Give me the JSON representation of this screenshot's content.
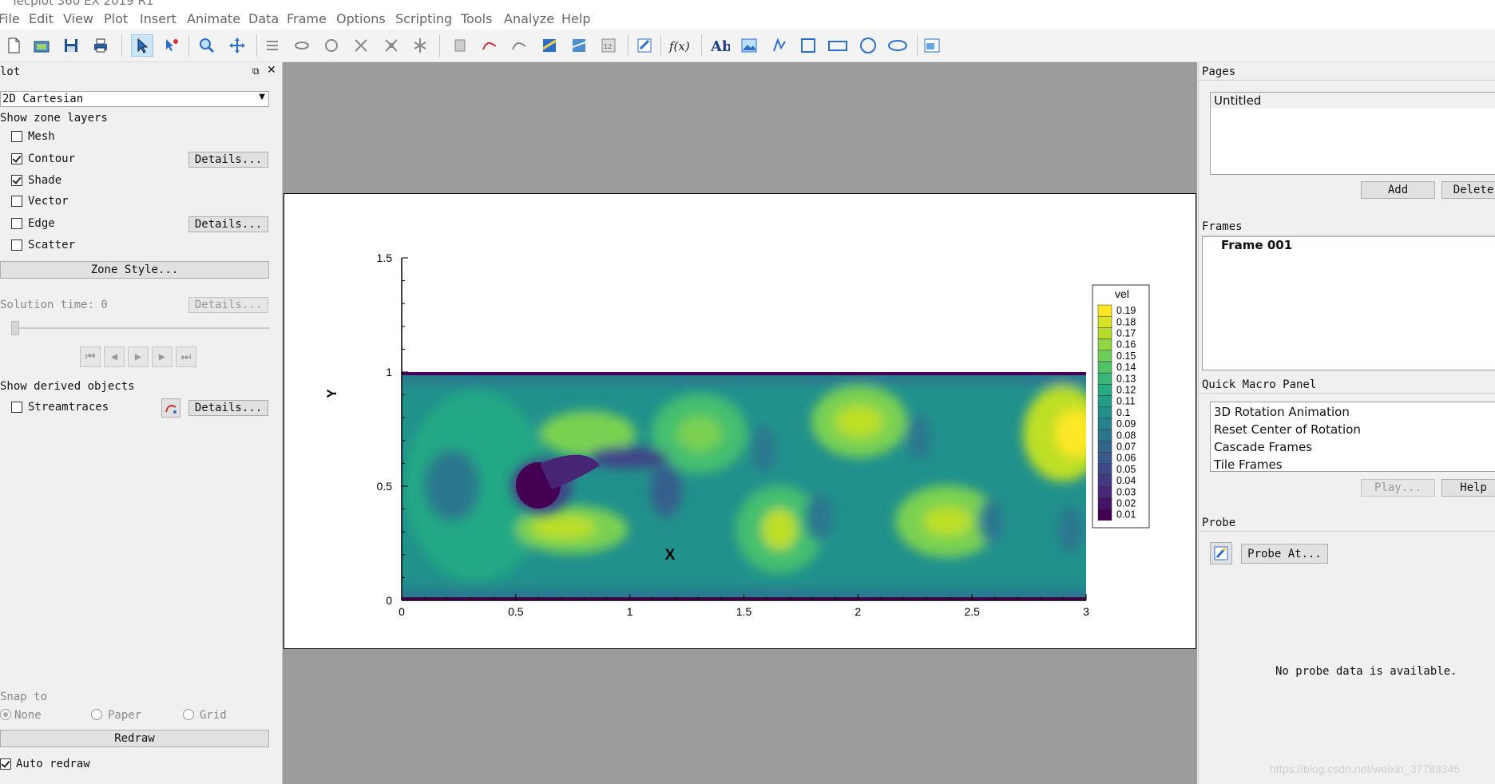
{
  "window": {
    "title": "Tecplot 360 EX 2019 R1"
  },
  "menu": [
    "File",
    "Edit",
    "View",
    "Plot",
    "Insert",
    "Animate",
    "Data",
    "Frame",
    "Options",
    "Scripting",
    "Tools",
    "Analyze",
    "Help"
  ],
  "left_panel": {
    "title": "lot",
    "plot_type": "2D Cartesian",
    "show_zone_layers": "Show zone layers",
    "layers": [
      {
        "label": "Mesh",
        "checked": false
      },
      {
        "label": "Contour",
        "checked": true,
        "details": "Details..."
      },
      {
        "label": "Shade",
        "checked": true
      },
      {
        "label": "Vector",
        "checked": false
      },
      {
        "label": "Edge",
        "checked": false,
        "details": "Details..."
      },
      {
        "label": "Scatter",
        "checked": false
      }
    ],
    "zone_style": "Zone Style...",
    "solution_time": "Solution time: 0",
    "solution_details": "Details...",
    "show_derived": "Show derived objects",
    "streamtraces": {
      "label": "Streamtraces",
      "checked": false,
      "details": "Details..."
    },
    "snap_to": "Snap to",
    "snap_options": [
      {
        "label": "None",
        "selected": true
      },
      {
        "label": "Paper",
        "selected": false
      },
      {
        "label": "Grid",
        "selected": false
      }
    ],
    "redraw": "Redraw",
    "auto_redraw": {
      "label": "Auto redraw",
      "checked": true
    }
  },
  "right_panel": {
    "pages_header": "Pages",
    "pages": [
      "Untitled"
    ],
    "add_button": "Add",
    "delete_button": "Delete",
    "frames_header": "Frames",
    "frames": [
      "Frame 001"
    ],
    "macro_header": "Quick Macro Panel",
    "macros": [
      "3D Rotation Animation",
      "Reset Center of Rotation",
      "Cascade Frames",
      "Tile Frames"
    ],
    "play_button": "Play...",
    "help_button": "Help",
    "probe_header": "Probe",
    "probe_button": "Probe At...",
    "probe_message": "No probe data is available."
  },
  "colors": {
    "accent": "#cce4f7",
    "workspace": "#9b9b9b"
  },
  "watermark": "https://blog.csdn.net/weixin_37783345",
  "chart_data": {
    "type": "heatmap",
    "xlabel": "X",
    "ylabel": "Y",
    "xlim": [
      0,
      3
    ],
    "ylim": [
      0,
      1.5
    ],
    "x_ticks": [
      "0",
      "0.5",
      "1",
      "1.5",
      "2",
      "2.5",
      "3"
    ],
    "y_ticks": [
      "0",
      "0.5",
      "1",
      "1.5"
    ],
    "domain": {
      "x": [
        0,
        3
      ],
      "y": [
        0,
        1
      ]
    },
    "legend": {
      "title": "vel",
      "placement": "right",
      "levels": [
        "0.19",
        "0.18",
        "0.17",
        "0.16",
        "0.15",
        "0.14",
        "0.13",
        "0.12",
        "0.11",
        "0.1",
        "0.09",
        "0.08",
        "0.07",
        "0.06",
        "0.05",
        "0.04",
        "0.03",
        "0.02",
        "0.01"
      ]
    },
    "colormap": [
      "#440154",
      "#482475",
      "#414487",
      "#355f8d",
      "#2a788e",
      "#21918c",
      "#22a884",
      "#44bf70",
      "#7ad151",
      "#bddf26",
      "#fde725"
    ]
  }
}
